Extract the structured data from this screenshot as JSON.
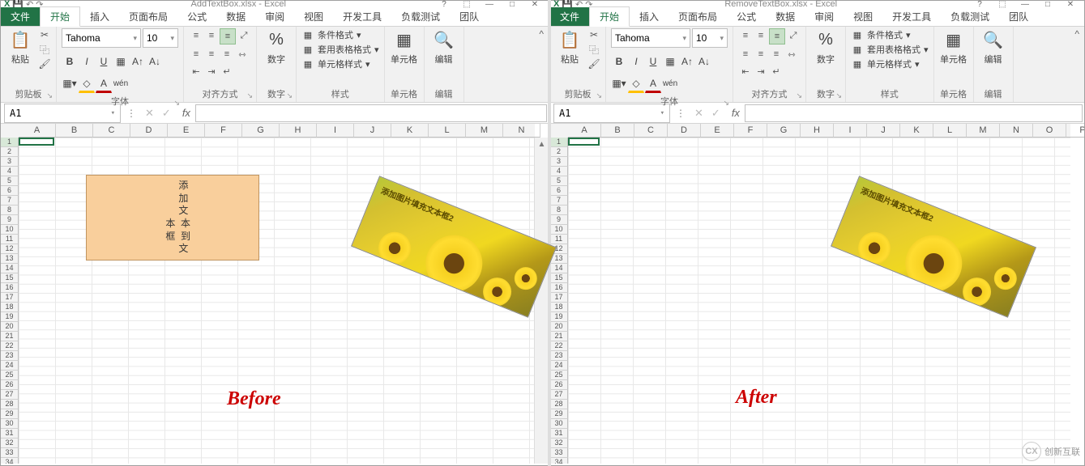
{
  "app": {
    "suffix": "Excel",
    "left_file": "AddTextBox.xlsx",
    "right_file": "RemoveTextBox.xlsx"
  },
  "tabs": {
    "file": "文件",
    "home": "开始",
    "insert": "插入",
    "layout": "页面布局",
    "formula": "公式",
    "data": "数据",
    "review": "审阅",
    "view": "视图",
    "dev": "开发工具",
    "load": "负载测试",
    "team": "团队"
  },
  "ribbon": {
    "clipboard": {
      "label": "剪贴板",
      "paste": "粘贴"
    },
    "font": {
      "label": "字体",
      "name": "Tahoma",
      "size": "10"
    },
    "align": {
      "label": "对齐方式"
    },
    "number": {
      "label": "数字",
      "btn": "数字"
    },
    "styles": {
      "label": "样式",
      "cond": "条件格式",
      "table": "套用表格格式",
      "cell": "单元格样式"
    },
    "cells": {
      "label": "单元格",
      "btn": "单元格"
    },
    "edit": {
      "label": "编辑",
      "btn": "编辑"
    }
  },
  "namebox": {
    "value": "A1",
    "fx": "fx"
  },
  "columns": [
    "A",
    "B",
    "C",
    "D",
    "E",
    "F",
    "G",
    "H",
    "I",
    "J",
    "K",
    "L",
    "M",
    "N"
  ],
  "columns_r": [
    "A",
    "B",
    "C",
    "D",
    "E",
    "F",
    "G",
    "H",
    "I",
    "J",
    "K",
    "L",
    "M",
    "N",
    "O",
    "P"
  ],
  "textbox1": "        添\n        加\n        文\n    本  本\n    框  到\n        文",
  "sunflower_text": "添加图片填充文本框2",
  "before": "Before",
  "after": "After",
  "watermark": {
    "logo": "CX",
    "text": "创新互联"
  },
  "help": "?"
}
